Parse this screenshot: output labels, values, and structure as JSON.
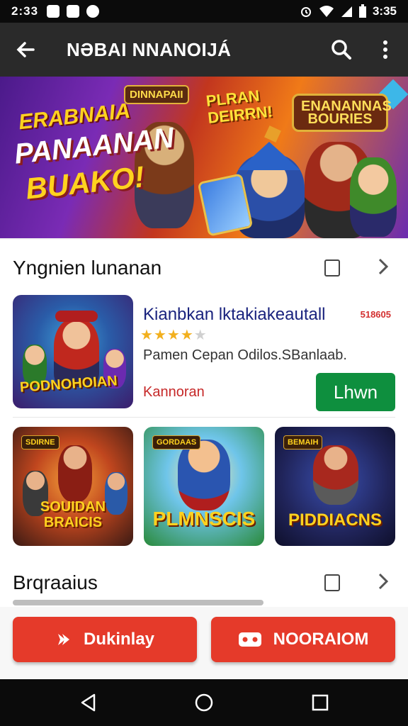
{
  "status_bar": {
    "time": "2:33",
    "battery": "3:35"
  },
  "app_bar": {
    "title": "NƏBAI NNANOIJÁ",
    "back_icon": "arrow-left-icon",
    "search_icon": "search-icon",
    "menu_icon": "more-vert-icon"
  },
  "banner": {
    "line1": "ERABNAIA",
    "line2": "PANAANAN",
    "line3": "BUAKO!",
    "logo_a": "DINNAPAII",
    "center_text": "PLRAN DEIRRN!",
    "logo_b": "ENANANNAS BOURIES"
  },
  "section1": {
    "title": "Yngnien lunanan",
    "featured": {
      "thumb_label": "PODNOHOIAN",
      "title": "Kianbkan lktakiakeautall",
      "tag": "518605",
      "rating": 4,
      "rating_max": 5,
      "description": "Pamen Cepan Odilos.SBanlaab.",
      "price": "Kannoran",
      "install_label": "Lhwn"
    },
    "tiles": [
      {
        "label": "SOUIDAN BRAICIS",
        "badge": "SDIRNE",
        "theme": "fire"
      },
      {
        "label": "PLMNSCIS",
        "badge": "GORDAAS",
        "theme": "sky"
      },
      {
        "label": "PIDDIACNS",
        "badge": "BEMAIH",
        "theme": "night"
      }
    ]
  },
  "section2": {
    "title": "Brqraaius"
  },
  "actions": [
    {
      "label": "Dukinlay",
      "icon": "chevron-right-icon"
    },
    {
      "label": "NOORAIOM",
      "icon": "gamepad-icon"
    }
  ],
  "nav_bar": {
    "back": "nav-back-icon",
    "home": "nav-home-icon",
    "recents": "nav-recents-icon"
  },
  "colors": {
    "appbar": "#2a2a2a",
    "install": "#0e8f3e",
    "cta": "#e53a2a",
    "title_blue": "#1a237e"
  }
}
